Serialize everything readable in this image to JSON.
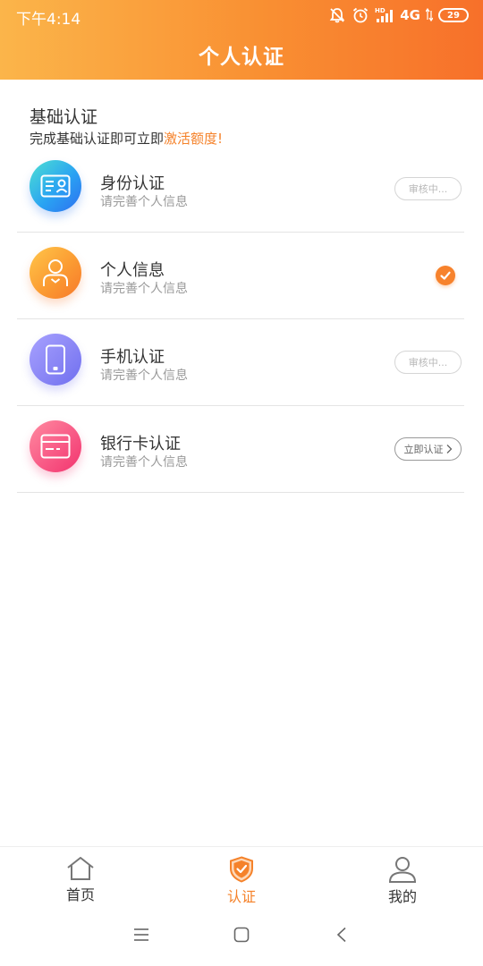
{
  "status_bar": {
    "time": "下午4:14",
    "network": "4G",
    "battery_level": "29"
  },
  "header": {
    "title": "个人认证"
  },
  "section": {
    "title": "基础认证",
    "subtitle_prefix": "完成基础认证即可立即",
    "subtitle_highlight": "激活额度!",
    "highlight_color": "#f5822a"
  },
  "auth_items": [
    {
      "name": "身份认证",
      "desc": "请完善个人信息",
      "icon": "id-card-icon",
      "status": "审核中..."
    },
    {
      "name": "个人信息",
      "desc": "请完善个人信息",
      "icon": "person-icon",
      "status": "done"
    },
    {
      "name": "手机认证",
      "desc": "请完善个人信息",
      "icon": "phone-icon",
      "status": "审核中..."
    },
    {
      "name": "银行卡认证",
      "desc": "请完善个人信息",
      "icon": "bank-card-icon",
      "status": "立即认证"
    }
  ],
  "bottom_nav": [
    {
      "label": "首页",
      "icon": "home-icon",
      "active": false
    },
    {
      "label": "认证",
      "icon": "shield-check-icon",
      "active": true
    },
    {
      "label": "我的",
      "icon": "user-icon",
      "active": false
    }
  ],
  "colors": {
    "accent": "#f5822a",
    "header_gradient_start": "#fbb54a",
    "header_gradient_end": "#f7702a"
  }
}
